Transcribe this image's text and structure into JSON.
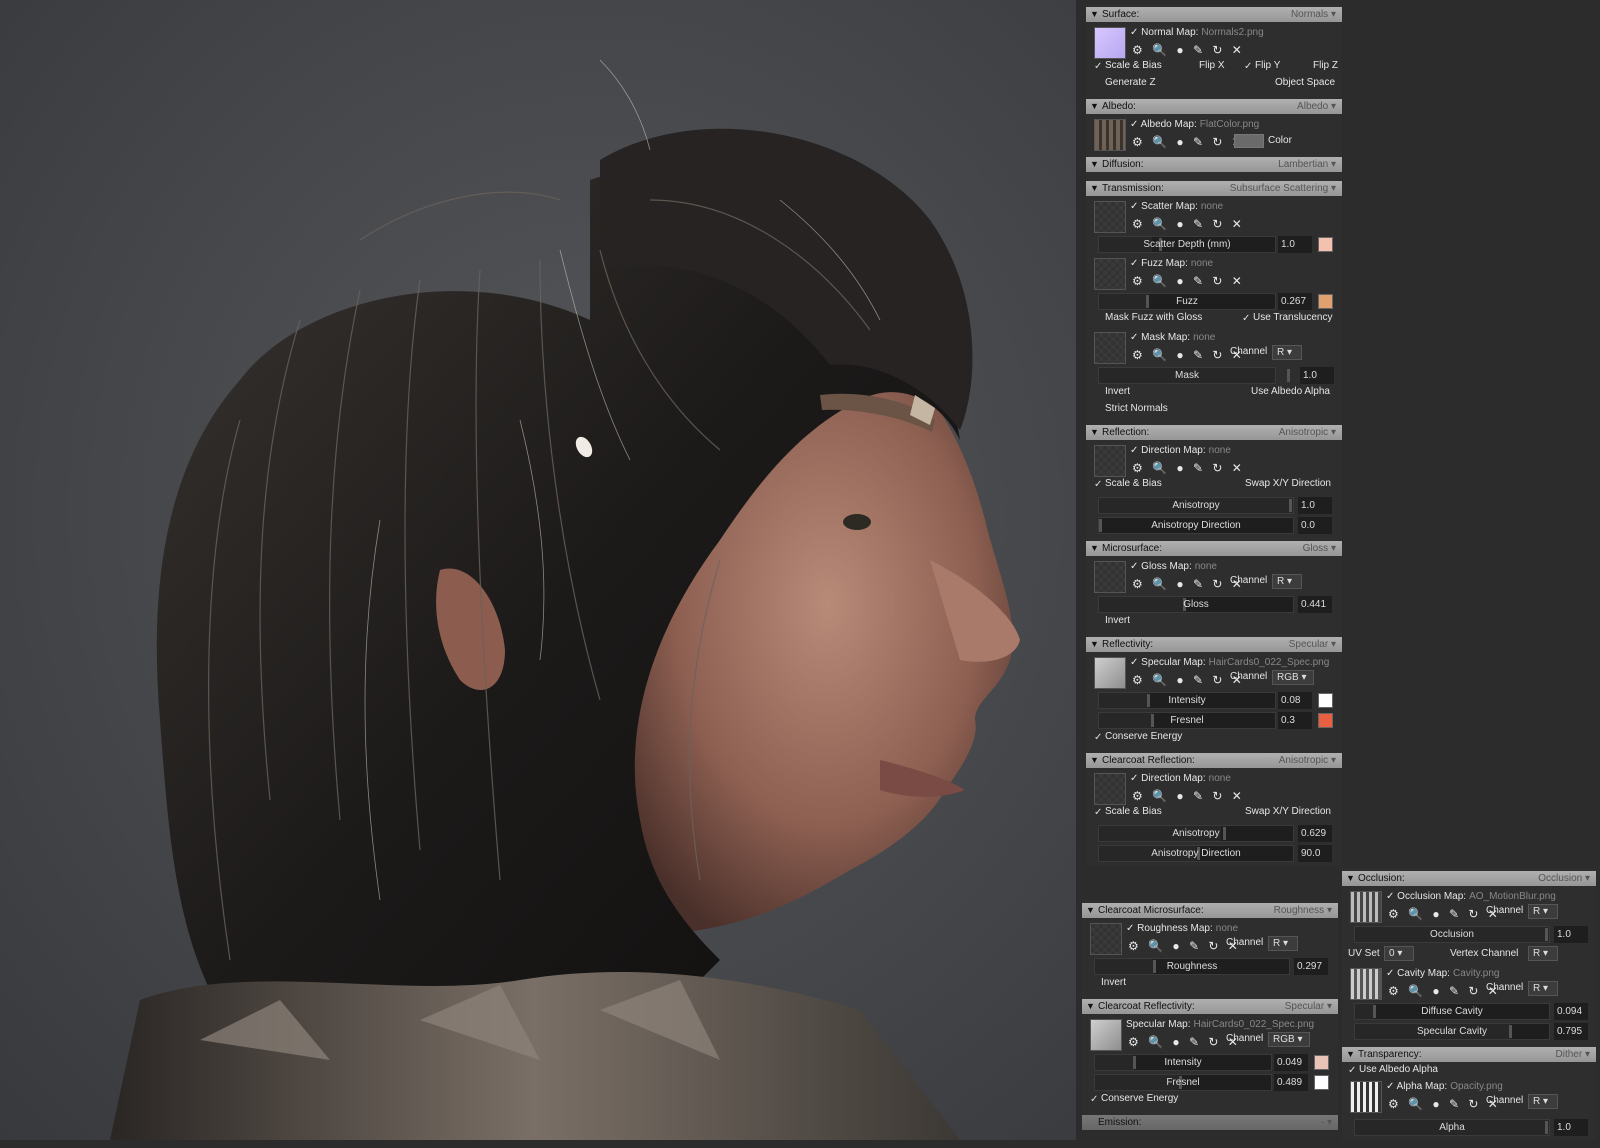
{
  "viewport": {
    "description": "rendered portrait"
  },
  "colors": {
    "normal_thumb": "#c9b8f0",
    "scatter": "#f4c0b0",
    "fuzz": "#e0a070",
    "spec_white": "#ffffff",
    "fresnel": "#e86040",
    "cc_intensity": "#e8c4b8"
  },
  "surface": {
    "title": "Surface:",
    "mode": "Normals",
    "map_label": "Normal Map:",
    "map_file": "Normals2.png",
    "scale_bias": "Scale & Bias",
    "flip_x": "Flip X",
    "flip_y": "Flip Y",
    "flip_z": "Flip Z",
    "generate_z": "Generate Z",
    "object_space": "Object Space"
  },
  "albedo": {
    "title": "Albedo:",
    "mode": "Albedo",
    "map_label": "Albedo Map:",
    "map_file": "FlatColor.png",
    "color_label": "Color"
  },
  "diffusion": {
    "title": "Diffusion:",
    "mode": "Lambertian"
  },
  "transmission": {
    "title": "Transmission:",
    "mode": "Subsurface Scattering",
    "scatter_label": "Scatter Map:",
    "scatter_file": "none",
    "depth_label": "Scatter Depth (mm)",
    "depth_val": "1.0",
    "fuzz_label": "Fuzz Map:",
    "fuzz_file": "none",
    "fuzz_slider": "Fuzz",
    "fuzz_val": "0.267",
    "mask_fuzz": "Mask Fuzz with Gloss",
    "use_transl": "Use Translucency",
    "mask_label": "Mask Map:",
    "mask_file": "none",
    "channel": "Channel",
    "channel_val": "R",
    "mask_slider": "Mask",
    "mask_val": "1.0",
    "invert": "Invert",
    "use_albedo_alpha": "Use Albedo Alpha",
    "strict_normals": "Strict Normals"
  },
  "reflection": {
    "title": "Reflection:",
    "mode": "Anisotropic",
    "map_label": "Direction Map:",
    "map_file": "none",
    "scale_bias": "Scale & Bias",
    "swap": "Swap X/Y Direction",
    "aniso": "Anisotropy",
    "aniso_val": "1.0",
    "aniso_dir": "Anisotropy Direction",
    "aniso_dir_val": "0.0"
  },
  "microsurface": {
    "title": "Microsurface:",
    "mode": "Gloss",
    "map_label": "Gloss Map:",
    "map_file": "none",
    "channel": "Channel",
    "channel_val": "R",
    "gloss": "Gloss",
    "gloss_val": "0.441",
    "invert": "Invert"
  },
  "reflectivity": {
    "title": "Reflectivity:",
    "mode": "Specular",
    "map_label": "Specular Map:",
    "map_file": "HairCards0_022_Spec.png",
    "channel": "Channel",
    "channel_val": "RGB",
    "intensity": "Intensity",
    "intensity_val": "0.08",
    "fresnel": "Fresnel",
    "fresnel_val": "0.3",
    "conserve": "Conserve Energy"
  },
  "cc_reflection": {
    "title": "Clearcoat Reflection:",
    "mode": "Anisotropic",
    "map_label": "Direction Map:",
    "map_file": "none",
    "scale_bias": "Scale & Bias",
    "swap": "Swap X/Y Direction",
    "aniso": "Anisotropy",
    "aniso_val": "0.629",
    "aniso_dir": "Anisotropy Direction",
    "aniso_dir_val": "90.0"
  },
  "cc_micro": {
    "title": "Clearcoat Microsurface:",
    "mode": "Roughness",
    "map_label": "Roughness Map:",
    "map_file": "none",
    "channel": "Channel",
    "channel_val": "R",
    "rough": "Roughness",
    "rough_val": "0.297",
    "invert": "Invert"
  },
  "cc_reflectivity": {
    "title": "Clearcoat Reflectivity:",
    "mode": "Specular",
    "map_label": "Specular Map:",
    "map_file": "HairCards0_022_Spec.png",
    "channel": "Channel",
    "channel_val": "RGB",
    "intensity": "Intensity",
    "intensity_val": "0.049",
    "fresnel": "Fresnel",
    "fresnel_val": "0.489",
    "conserve": "Conserve Energy"
  },
  "emission": {
    "title": "Emission:",
    "mode": "-"
  },
  "occlusion": {
    "title": "Occlusion:",
    "mode": "Occlusion",
    "map_label": "Occlusion Map:",
    "map_file": "AO_MotionBlur.png",
    "channel": "Channel",
    "channel_val": "R",
    "occ": "Occlusion",
    "occ_val": "1.0",
    "uvset": "UV Set",
    "uvset_val": "0",
    "vertex_channel": "Vertex Channel",
    "vertex_val": "R",
    "cavity_label": "Cavity Map:",
    "cavity_file": "Cavity.png",
    "diffuse_cavity": "Diffuse Cavity",
    "diffuse_cavity_val": "0.094",
    "spec_cavity": "Specular Cavity",
    "spec_cavity_val": "0.795"
  },
  "transparency": {
    "title": "Transparency:",
    "mode": "Dither",
    "use_albedo_alpha": "Use Albedo Alpha",
    "map_label": "Alpha Map:",
    "map_file": "Opacity.png",
    "channel": "Channel",
    "channel_val": "R",
    "alpha": "Alpha",
    "alpha_val": "1.0"
  },
  "toolbar_glyphs": "⚙ 🔍 ● ✎ ↻ ✕"
}
